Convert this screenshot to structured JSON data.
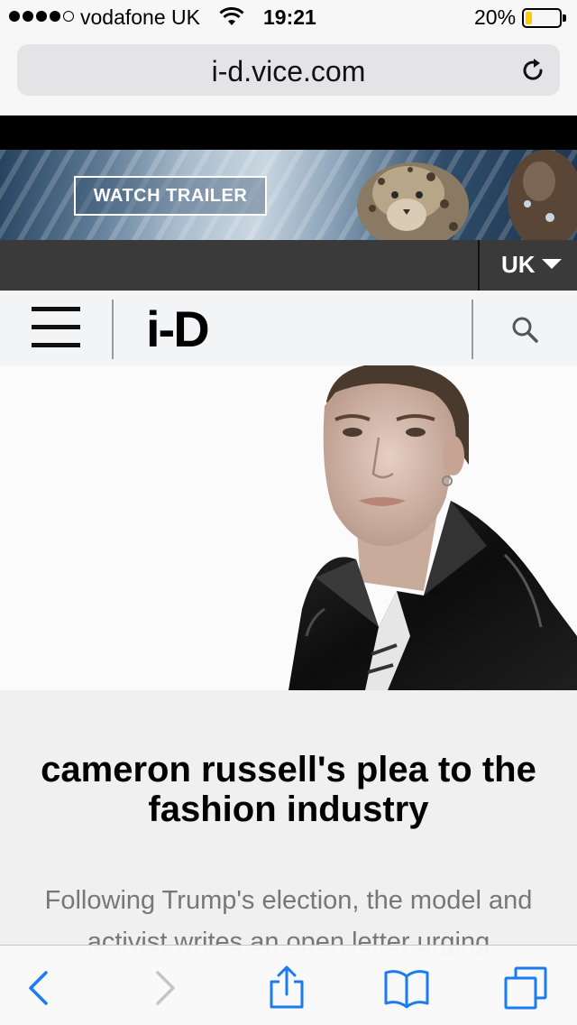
{
  "status_bar": {
    "carrier": "vodafone UK",
    "time": "19:21",
    "battery_percent_label": "20%",
    "battery_level": 0.2,
    "signal_bars": 4,
    "signal_total": 5,
    "icons": [
      "wifi-icon",
      "battery-icon"
    ]
  },
  "browser": {
    "url": "i-d.vice.com",
    "reload_icon": "reload-icon",
    "toolbar_icons": [
      "back-icon",
      "forward-icon",
      "share-icon",
      "bookmarks-icon",
      "tabs-icon"
    ],
    "accent": "#1a7cf1"
  },
  "ad": {
    "button_label": "WATCH TRAILER"
  },
  "region": {
    "label": "UK"
  },
  "site": {
    "logo_text": "i-D",
    "menu_icon": "menu-icon",
    "search_icon": "search-icon"
  },
  "article": {
    "headline": "cameron russell's plea to the fashion industry",
    "standfirst": "Following Trump's election, the model and activist writes an open letter urging"
  }
}
